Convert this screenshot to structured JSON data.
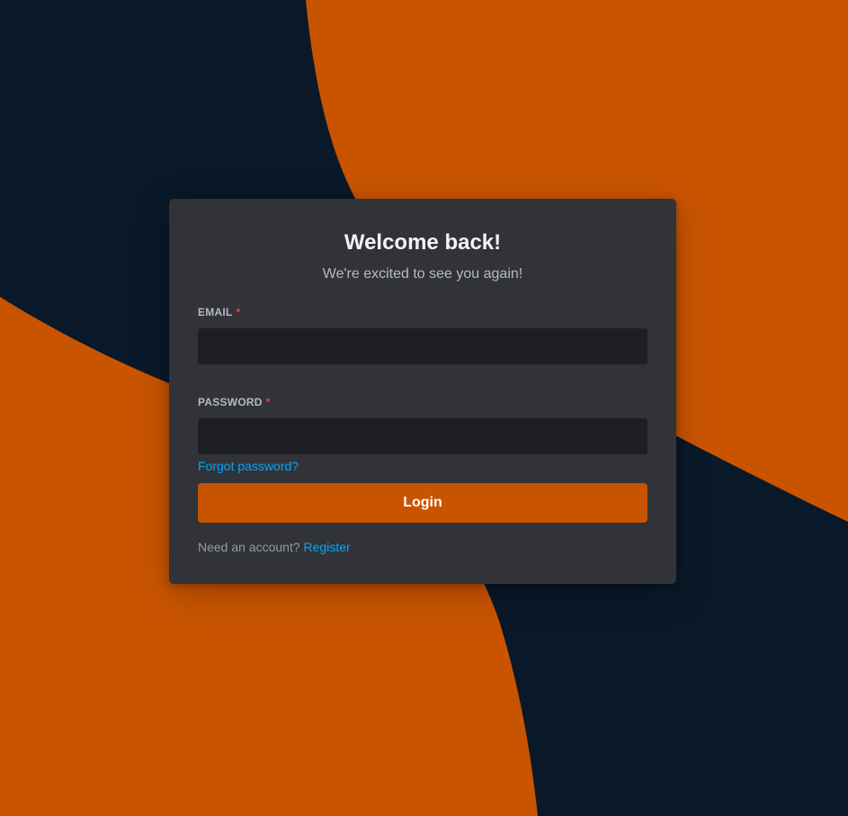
{
  "colors": {
    "background_dark": "#0a1929",
    "background_orange": "#c95400",
    "card": "#313338",
    "input": "#1e1f22",
    "link": "#00a8fc",
    "required": "#f23f43"
  },
  "login": {
    "title": "Welcome back!",
    "subtitle": "We're excited to see you again!",
    "email": {
      "label": "EMAIL",
      "required_mark": "*",
      "value": ""
    },
    "password": {
      "label": "PASSWORD",
      "required_mark": "*",
      "value": ""
    },
    "forgot_password": "Forgot password?",
    "login_button": "Login",
    "register_prompt": "Need an account?",
    "register_link": "Register"
  }
}
